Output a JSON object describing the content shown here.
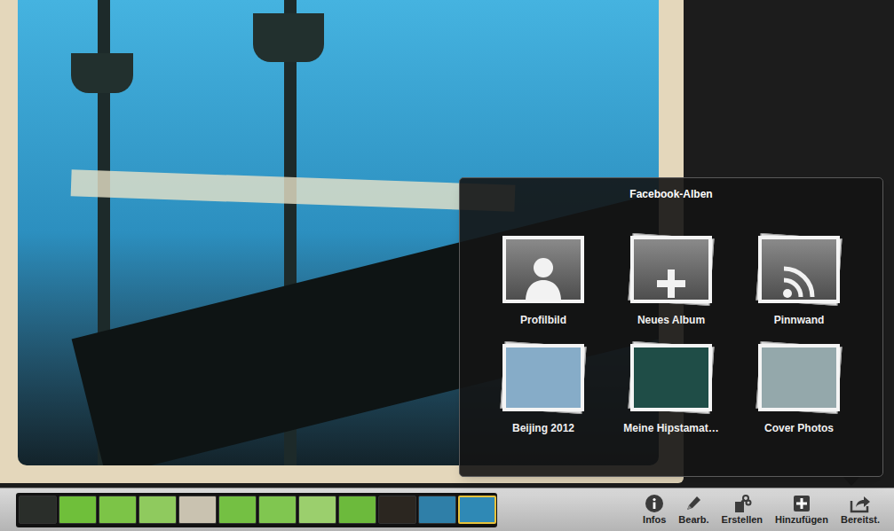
{
  "viewer": {
    "thumbnails": [
      {
        "selected": false,
        "color": "#2a2e2a"
      },
      {
        "selected": false,
        "color": "#6fbf3a"
      },
      {
        "selected": false,
        "color": "#7cc447"
      },
      {
        "selected": false,
        "color": "#8fca5e"
      },
      {
        "selected": false,
        "color": "#c9c2b0"
      },
      {
        "selected": false,
        "color": "#74c043"
      },
      {
        "selected": false,
        "color": "#80c650"
      },
      {
        "selected": false,
        "color": "#9bcf6d"
      },
      {
        "selected": false,
        "color": "#6cba3c"
      },
      {
        "selected": false,
        "color": "#2b2620"
      },
      {
        "selected": false,
        "color": "#2f7fa8"
      },
      {
        "selected": true,
        "color": "#2f89b5"
      }
    ]
  },
  "popover": {
    "title": "Facebook-Alben",
    "albums": [
      {
        "label": "Profilbild",
        "kind": "profile"
      },
      {
        "label": "Neues Album",
        "kind": "new"
      },
      {
        "label": "Pinnwand",
        "kind": "wall"
      },
      {
        "label": "Beijing 2012",
        "kind": "photo",
        "color": "#86acc8"
      },
      {
        "label": "Meine Hipstamat…",
        "kind": "photo",
        "color": "#1f4d47"
      },
      {
        "label": "Cover Photos",
        "kind": "photo",
        "color": "#94a8ab"
      }
    ]
  },
  "toolbar": {
    "buttons": [
      {
        "label": "Infos",
        "kind": "info"
      },
      {
        "label": "Bearb.",
        "kind": "edit"
      },
      {
        "label": "Erstellen",
        "kind": "create"
      },
      {
        "label": "Hinzufügen",
        "kind": "add"
      },
      {
        "label": "Bereitst.",
        "kind": "share"
      }
    ]
  }
}
